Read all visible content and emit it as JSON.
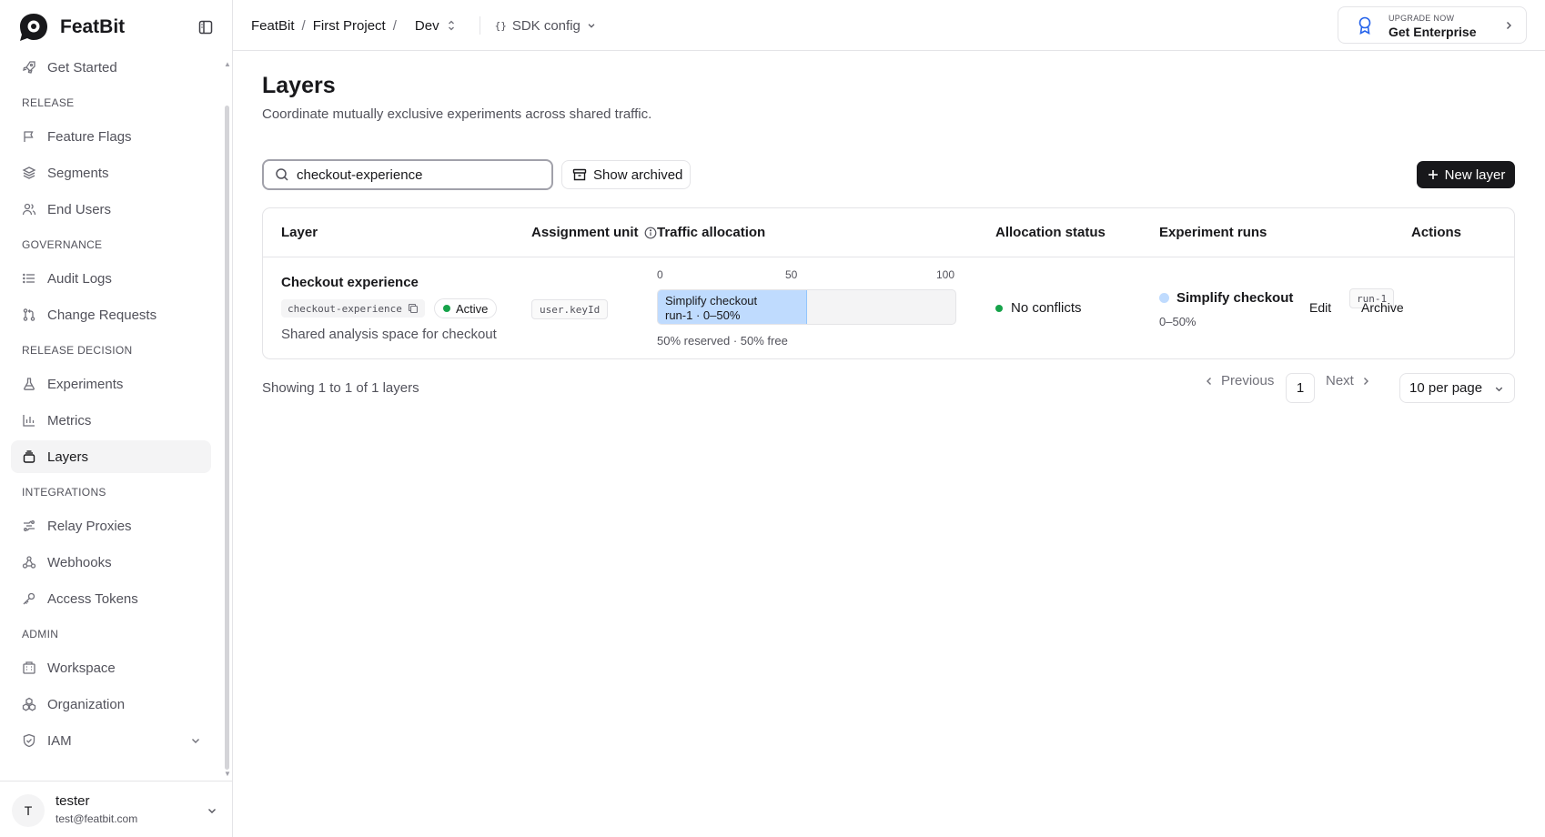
{
  "brand": {
    "name": "FeatBit"
  },
  "sidebar": {
    "top_item": "Get Started",
    "sections": {
      "release": "RELEASE",
      "governance": "GOVERNANCE",
      "release_decision": "RELEASE DECISION",
      "integrations": "INTEGRATIONS",
      "admin": "ADMIN"
    },
    "items": {
      "feature_flags": "Feature Flags",
      "segments": "Segments",
      "end_users": "End Users",
      "audit_logs": "Audit Logs",
      "change_requests": "Change Requests",
      "experiments": "Experiments",
      "metrics": "Metrics",
      "layers": "Layers",
      "relay_proxies": "Relay Proxies",
      "webhooks": "Webhooks",
      "access_tokens": "Access Tokens",
      "workspace": "Workspace",
      "organization": "Organization",
      "iam": "IAM"
    },
    "active_item": "Layers",
    "user": {
      "initial": "T",
      "name": "tester",
      "email": "test@featbit.com"
    }
  },
  "header": {
    "breadcrumb": {
      "workspace": "FeatBit",
      "project": "First Project",
      "separator": "/",
      "environment": "Dev"
    },
    "sdk_config": "SDK config",
    "upgrade": {
      "eyebrow": "UPGRADE NOW",
      "label": "Get Enterprise"
    }
  },
  "main": {
    "title": "Layers",
    "description": "Coordinate mutually exclusive experiments across shared traffic.",
    "search": {
      "value": "checkout-experience",
      "placeholder": ""
    },
    "show_archived": "Show archived",
    "new_layer": "New layer",
    "table": {
      "headers": {
        "layer": "Layer",
        "assignment_unit": "Assignment unit",
        "traffic_allocation": "Traffic allocation",
        "allocation_status": "Allocation status",
        "experiment_runs": "Experiment runs",
        "actions": "Actions"
      },
      "axis_ticks": [
        "0",
        "50",
        "100"
      ],
      "rows": [
        {
          "name": "Checkout experience",
          "key": "checkout-experience",
          "status": "Active",
          "description": "Shared analysis space for checkout",
          "assignment_unit": "user.keyId",
          "allocation": {
            "segment_name": "Simplify checkout",
            "segment_detail": "run-1 · 0–50%",
            "percent": 50,
            "summary": "50% reserved · 50% free"
          },
          "allocation_status": "No conflicts",
          "run": {
            "name": "Simplify checkout",
            "range": "0–50%",
            "id": "run-1"
          },
          "actions": {
            "edit": "Edit",
            "archive": "Archive"
          }
        }
      ]
    },
    "pagination": {
      "showing": "Showing 1 to 1 of 1 layers",
      "previous": "Previous",
      "current_page": "1",
      "next": "Next",
      "per_page": "10 per page"
    }
  },
  "colors": {
    "primary": "#18181b",
    "accent_blue": "#2563eb",
    "allocation_fill": "#bfdbfe",
    "status_green": "#16a34a",
    "border": "#e4e4e7"
  }
}
